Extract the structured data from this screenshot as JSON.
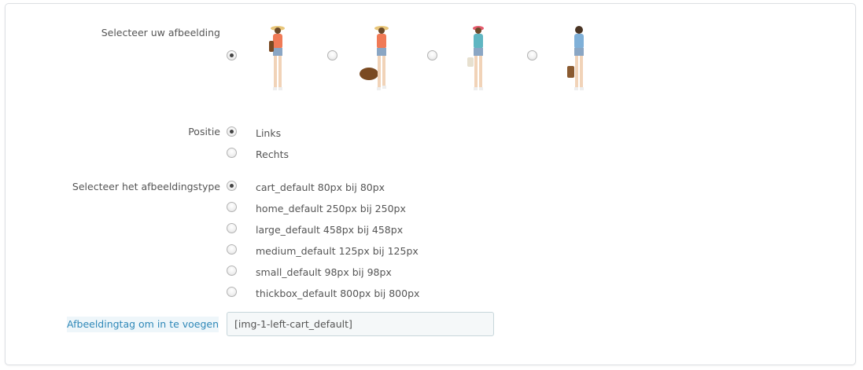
{
  "image_select": {
    "label": "Selecteer uw afbeelding",
    "options": [
      {
        "name": "image-option-1",
        "checked": true
      },
      {
        "name": "image-option-2",
        "checked": false
      },
      {
        "name": "image-option-3",
        "checked": false
      },
      {
        "name": "image-option-4",
        "checked": false
      }
    ]
  },
  "position": {
    "label": "Positie",
    "options": [
      {
        "label": "Links",
        "checked": true
      },
      {
        "label": "Rechts",
        "checked": false
      }
    ]
  },
  "image_type": {
    "label": "Selecteer het afbeeldingstype",
    "options": [
      {
        "label": "cart_default 80px bij 80px",
        "checked": true
      },
      {
        "label": "home_default 250px bij 250px",
        "checked": false
      },
      {
        "label": "large_default 458px bij 458px",
        "checked": false
      },
      {
        "label": "medium_default 125px bij 125px",
        "checked": false
      },
      {
        "label": "small_default 98px bij 98px",
        "checked": false
      },
      {
        "label": "thickbox_default 800px bij 800px",
        "checked": false
      }
    ]
  },
  "image_tag": {
    "label": "Afbeeldingtag om in te voegen",
    "value": "[img-1-left-cart_default]"
  },
  "colors": {
    "highlight_label": "#2f88b8",
    "highlight_bg": "#eef6fa"
  }
}
